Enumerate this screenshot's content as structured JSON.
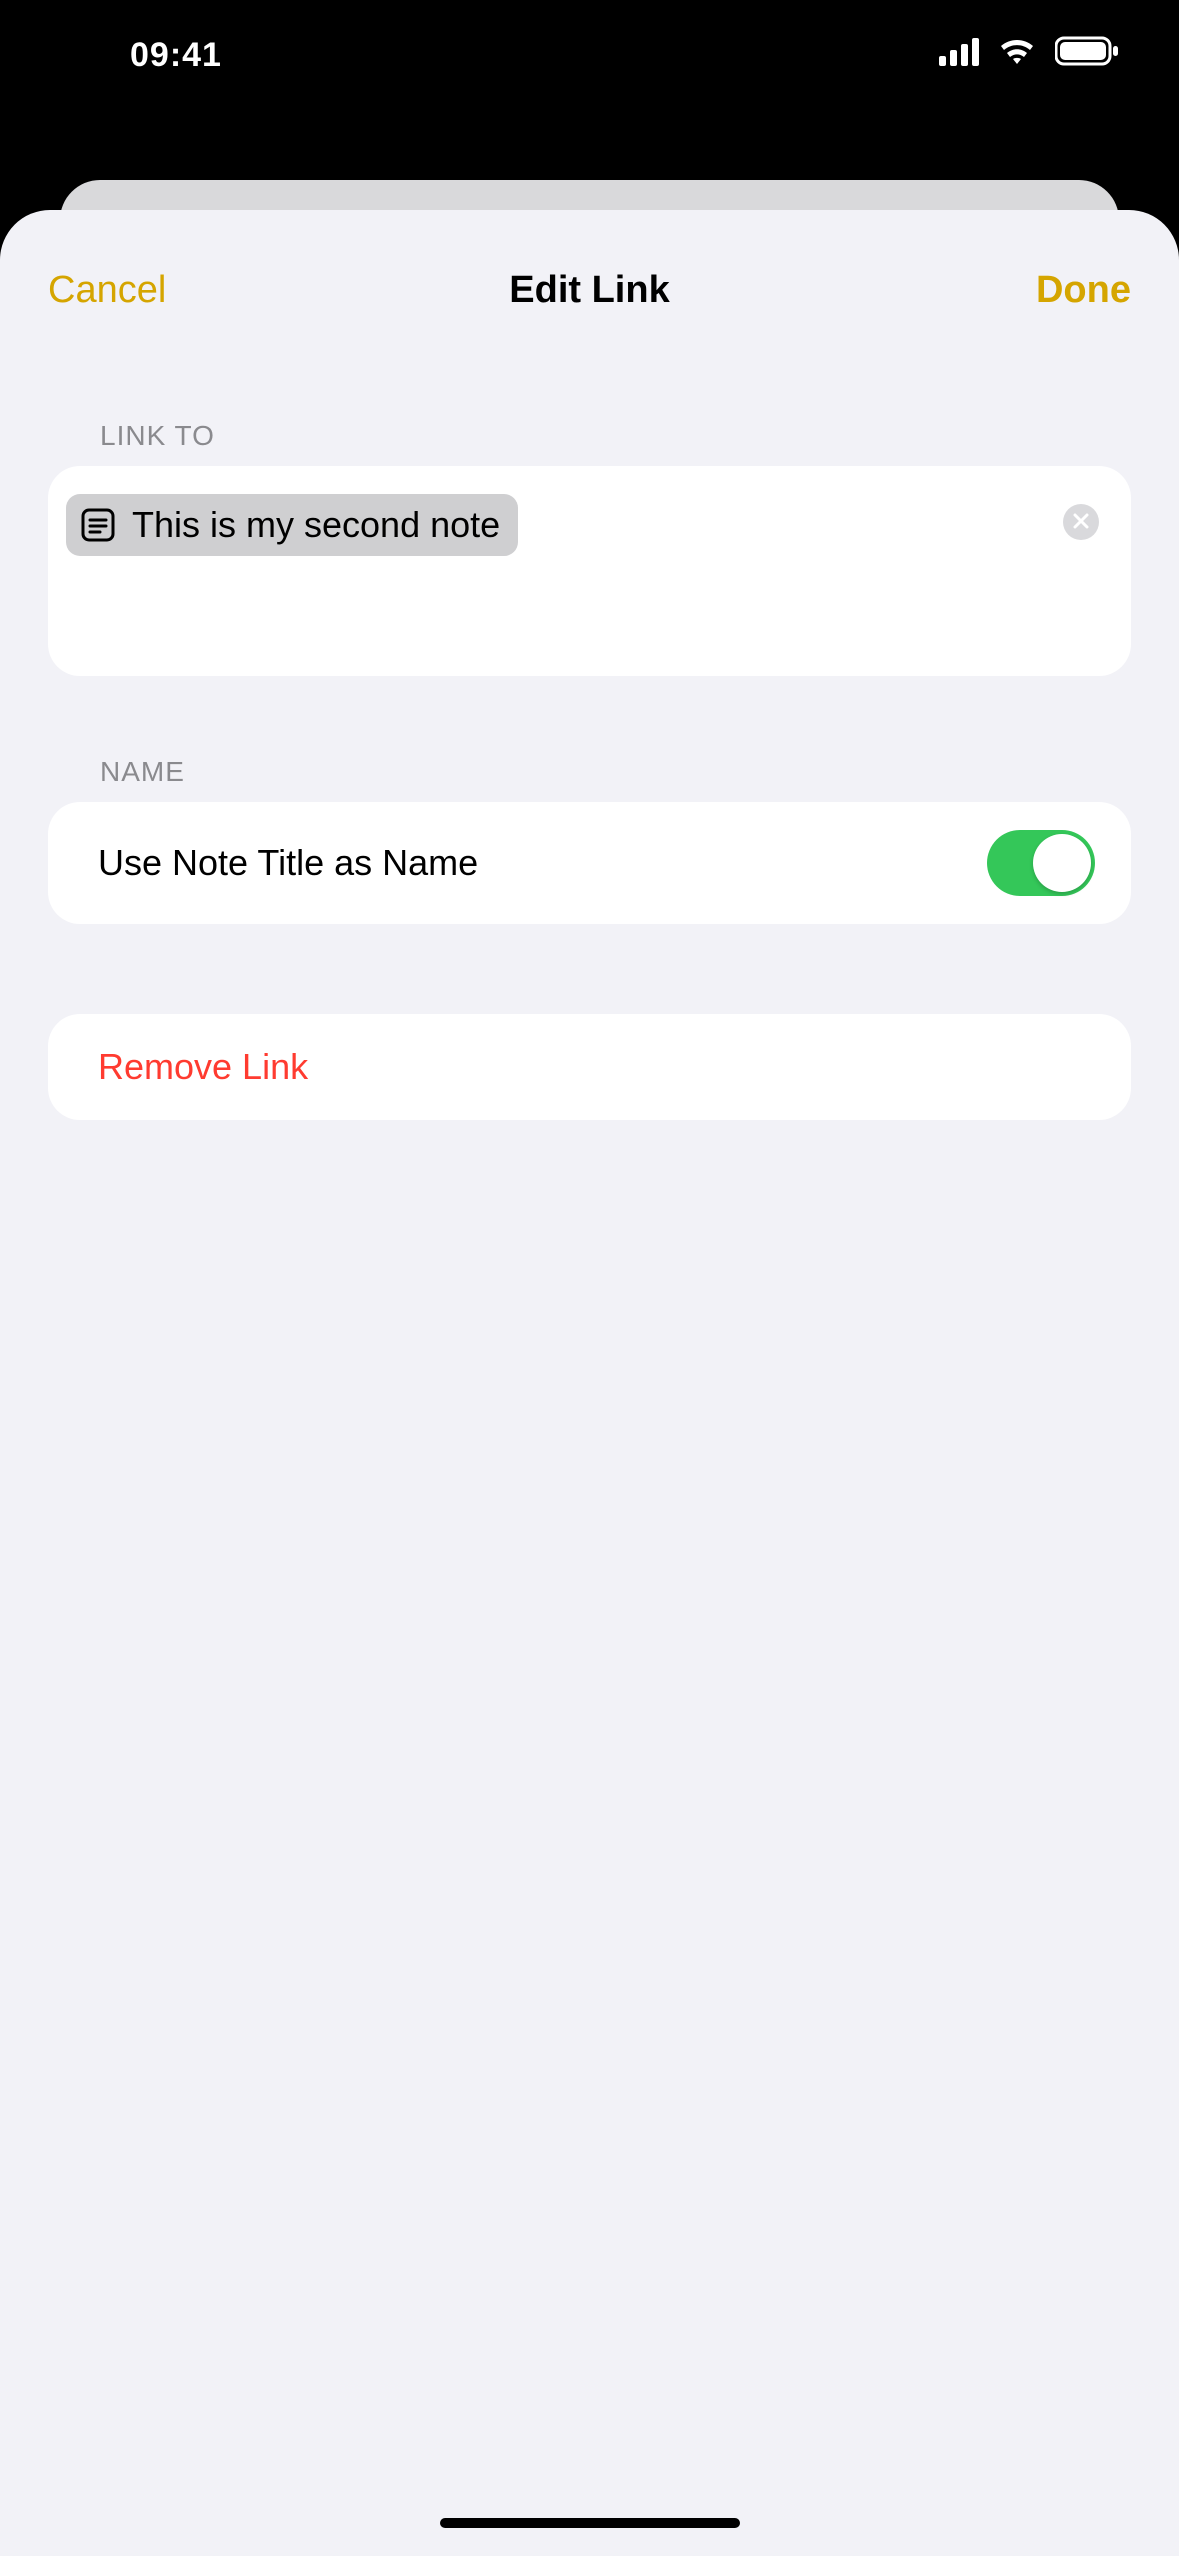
{
  "status": {
    "time": "09:41"
  },
  "modal": {
    "cancel": "Cancel",
    "title": "Edit Link",
    "done": "Done",
    "link_to_label": "LINK TO",
    "note_chip": "This is my second note",
    "name_label": "NAME",
    "use_note_title_label": "Use Note Title as Name",
    "toggle_on": true,
    "remove_link": "Remove Link"
  },
  "colors": {
    "accent": "#D5A500",
    "destructive": "#FF3B30",
    "toggle_on": "#34C759",
    "sheet_bg": "#F2F2F7"
  }
}
